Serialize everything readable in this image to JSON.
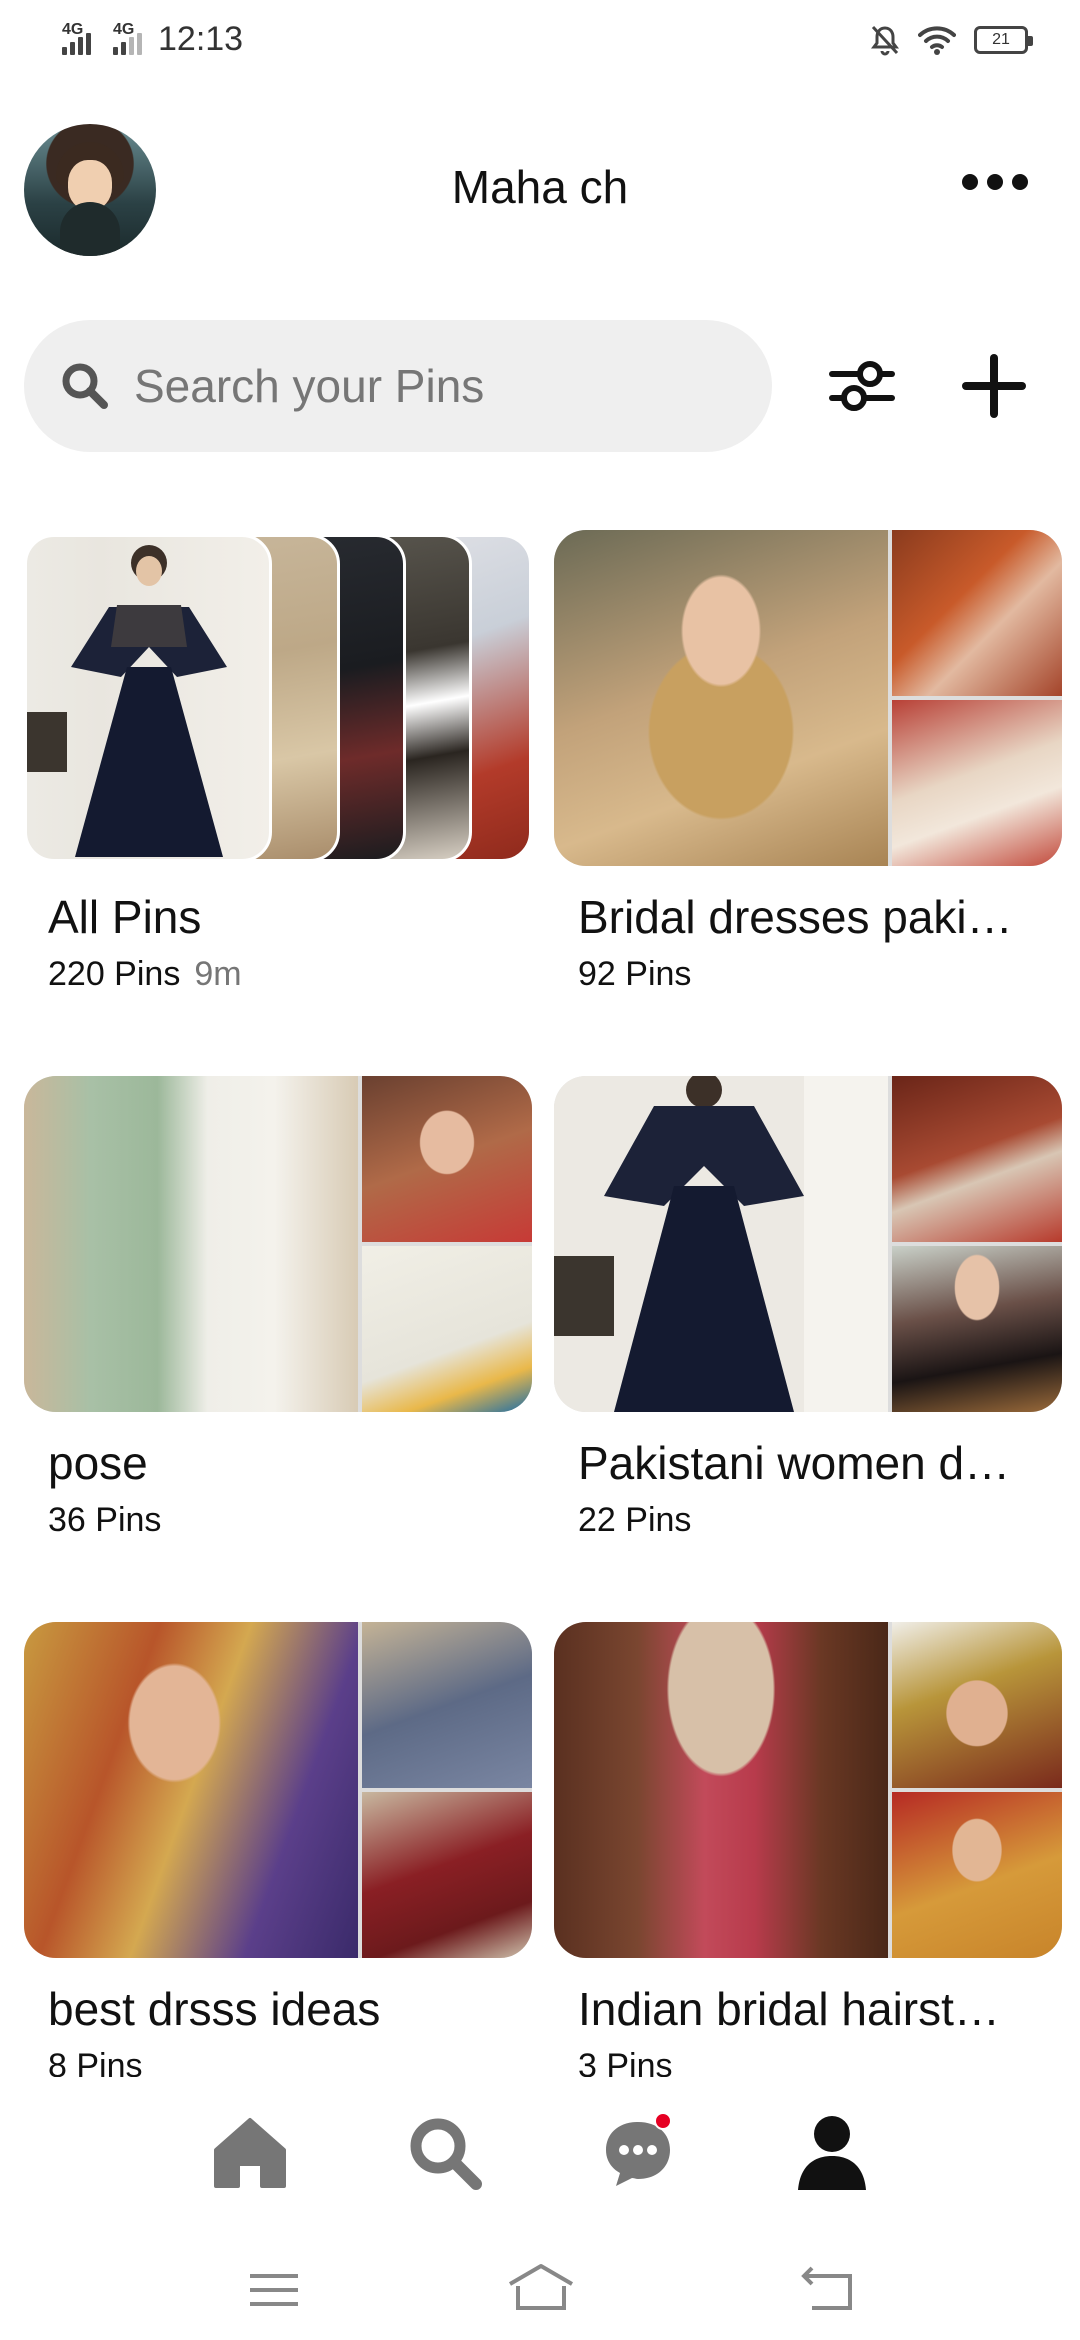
{
  "status_bar": {
    "network_1": "4G",
    "network_2": "4G",
    "time": "12:13",
    "battery": "21",
    "icons": [
      "signal-icon",
      "signal-icon",
      "mute-bell-icon",
      "wifi-icon",
      "battery-icon"
    ]
  },
  "header": {
    "profile_name": "Maha ch",
    "avatar_icon": "avatar",
    "more_icon": "more-dots-icon"
  },
  "search": {
    "placeholder": "Search your Pins",
    "icon": "search-icon",
    "filter_icon": "filter-sliders-icon",
    "add_icon": "plus-icon"
  },
  "boards": [
    {
      "title": "All Pins",
      "count": "220 Pins",
      "ago": "9m"
    },
    {
      "title": "Bridal dresses paki…",
      "count": "92 Pins"
    },
    {
      "title": "pose",
      "count": "36 Pins"
    },
    {
      "title": "Pakistani women d…",
      "count": "22 Pins"
    },
    {
      "title": "best drsss ideas",
      "count": "8 Pins"
    },
    {
      "title": "Indian bridal hairst…",
      "count": "3 Pins"
    }
  ],
  "bottom_nav": {
    "items": [
      "home-icon",
      "search-icon",
      "messages-icon",
      "profile-icon"
    ],
    "notification_dot_color": "#e60023"
  },
  "system_nav": [
    "menu-icon",
    "home-outline-icon",
    "back-icon"
  ]
}
